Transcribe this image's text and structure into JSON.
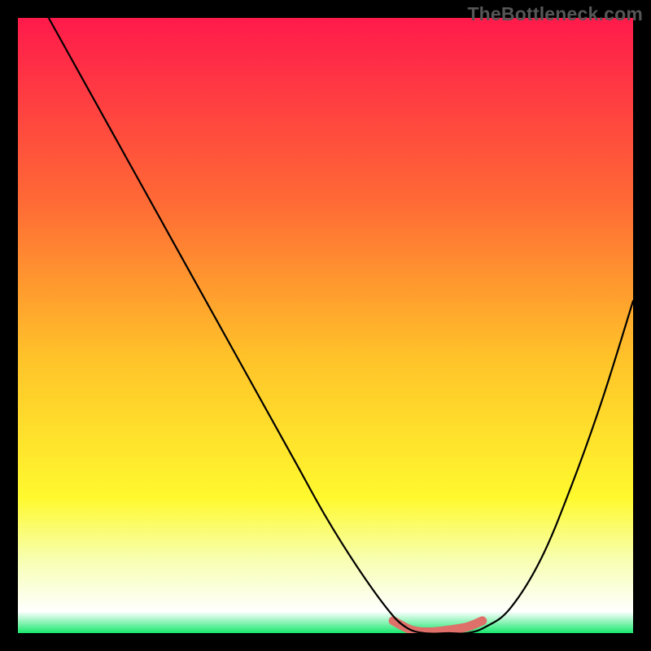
{
  "watermark": "TheBottleneck.com",
  "chart_data": {
    "type": "line",
    "title": "",
    "xlabel": "",
    "ylabel": "",
    "xlim": [
      0,
      100
    ],
    "ylim": [
      0,
      100
    ],
    "background_gradient": {
      "stops": [
        {
          "offset": 0.0,
          "color": "#ff1a4b"
        },
        {
          "offset": 0.3,
          "color": "#ff6a35"
        },
        {
          "offset": 0.55,
          "color": "#ffc229"
        },
        {
          "offset": 0.78,
          "color": "#fff92e"
        },
        {
          "offset": 0.88,
          "color": "#f7ffb0"
        },
        {
          "offset": 0.965,
          "color": "#ffffff"
        },
        {
          "offset": 1.0,
          "color": "#17e86d"
        }
      ]
    },
    "series": [
      {
        "name": "bottleneck-curve",
        "x": [
          5,
          10,
          15,
          20,
          25,
          30,
          35,
          40,
          45,
          50,
          55,
          60,
          63,
          66,
          70,
          73,
          76,
          80,
          85,
          90,
          95,
          100
        ],
        "y": [
          100,
          91,
          82,
          73,
          64,
          55,
          46,
          37,
          28,
          19,
          11,
          4,
          1,
          0,
          0,
          0,
          1,
          4,
          12,
          24,
          38,
          54
        ]
      }
    ],
    "accent_segment": {
      "name": "bottom-highlight",
      "x": [
        61,
        64,
        67,
        70,
        73,
        75.5
      ],
      "y": [
        2,
        0.5,
        0.2,
        0.5,
        1,
        2
      ]
    }
  }
}
